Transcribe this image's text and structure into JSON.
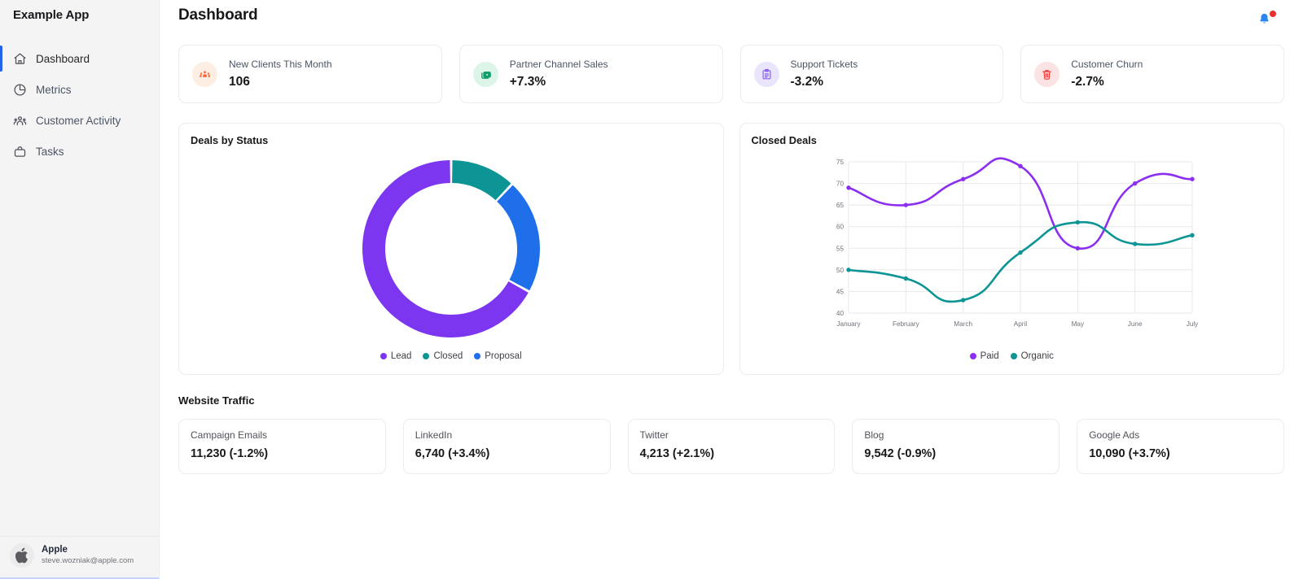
{
  "sidebar": {
    "brand": "Example App",
    "items": [
      {
        "label": "Dashboard",
        "icon": "home-icon",
        "active": true
      },
      {
        "label": "Metrics",
        "icon": "pie-chart-icon",
        "active": false
      },
      {
        "label": "Customer Activity",
        "icon": "users-icon",
        "active": false
      },
      {
        "label": "Tasks",
        "icon": "briefcase-icon",
        "active": false
      }
    ],
    "user": {
      "name": "Apple",
      "email": "steve.wozniak@apple.com",
      "avatar_icon": "apple-logo-icon"
    }
  },
  "header": {
    "title": "Dashboard",
    "notifications_icon": "bell-icon",
    "has_unread": true,
    "bell_color": "#2b85f5",
    "badge_color": "#ef2f2f"
  },
  "stats": [
    {
      "label": "New Clients This Month",
      "value": "106",
      "icon": "users-group-icon",
      "icon_color": "#f9703e",
      "bg_color": "#fdeee4"
    },
    {
      "label": "Partner Channel Sales",
      "value": "+7.3%",
      "icon": "credit-cards-icon",
      "icon_color": "#0f9f6e",
      "bg_color": "#dcf5e8"
    },
    {
      "label": "Support Tickets",
      "value": "-3.2%",
      "icon": "clipboard-icon",
      "icon_color": "#8b5cf6",
      "bg_color": "#e8e5fd"
    },
    {
      "label": "Customer Churn",
      "value": "-2.7%",
      "icon": "trash-icon",
      "icon_color": "#ef3b3b",
      "bg_color": "#fbe3e4"
    }
  ],
  "chart_data": [
    {
      "type": "pie",
      "title": "Deals by Status",
      "variant": "donut",
      "labels": [
        "Lead",
        "Closed",
        "Proposal"
      ],
      "values": [
        67,
        12,
        21
      ],
      "colors": [
        "#7c36f0",
        "#0d9494",
        "#1f6feb"
      ],
      "legend_position": "bottom",
      "start_angle_deg": 0,
      "inner_radius_ratio": 0.74
    },
    {
      "type": "line",
      "title": "Closed Deals",
      "categories": [
        "January",
        "February",
        "March",
        "April",
        "May",
        "June",
        "July"
      ],
      "series": [
        {
          "name": "Paid",
          "values": [
            69,
            65,
            71,
            74,
            55,
            70,
            71
          ],
          "color": "#8b2ef0"
        },
        {
          "name": "Organic",
          "values": [
            50,
            48,
            43,
            54,
            61,
            56,
            58
          ],
          "color": "#0d9494"
        }
      ],
      "ylim": [
        40,
        75
      ],
      "yticks": [
        40,
        45,
        50,
        55,
        60,
        65,
        70,
        75
      ],
      "xlabel": "",
      "ylabel": "",
      "grid": true,
      "legend_position": "bottom",
      "curve": "smooth",
      "markers": true
    }
  ],
  "traffic": {
    "title": "Website Traffic",
    "cards": [
      {
        "label": "Campaign Emails",
        "value": "11,230 (-1.2%)"
      },
      {
        "label": "LinkedIn",
        "value": "6,740 (+3.4%)"
      },
      {
        "label": "Twitter",
        "value": "4,213 (+2.1%)"
      },
      {
        "label": "Blog",
        "value": "9,542 (-0.9%)"
      },
      {
        "label": "Google Ads",
        "value": "10,090 (+3.7%)"
      }
    ]
  }
}
